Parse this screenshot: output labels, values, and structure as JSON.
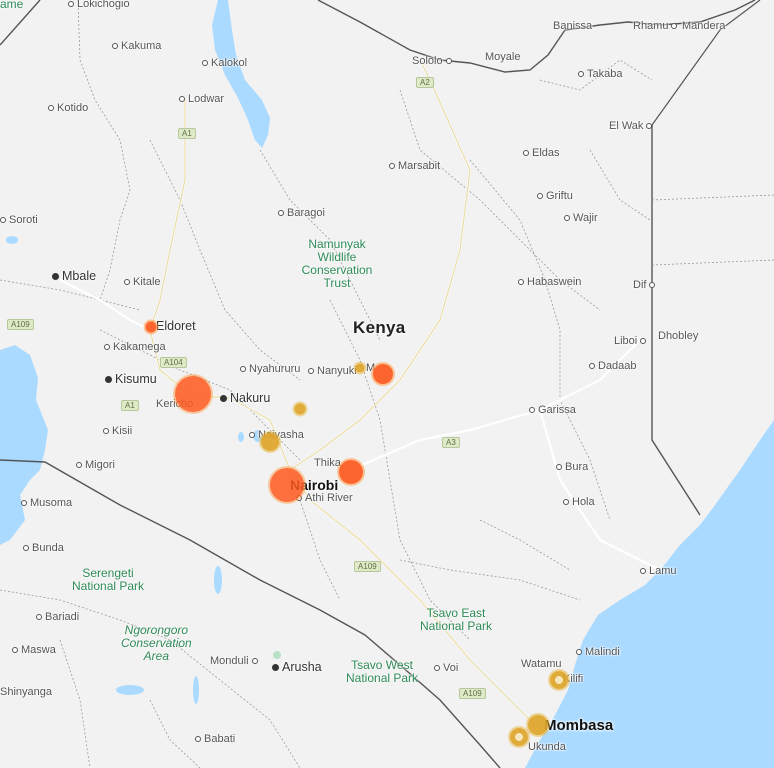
{
  "country": "Kenya",
  "colors": {
    "land": "#f2f2f2",
    "water": "#aadaff",
    "park": "#2e8b57",
    "marker_red": "#ff5a1f",
    "marker_gold": "#e0a52a"
  },
  "labels": {
    "lokichogio": "Lokichogio",
    "ame": "ame",
    "banissa": "Banissa",
    "rhamu": "Rhamu",
    "mandera": "Mandera",
    "kakuma": "Kakuma",
    "kalokol": "Kalokol",
    "sololo": "Sololo",
    "moyale": "Moyale",
    "takaba": "Takaba",
    "lodwar": "Lodwar",
    "kotido": "Kotido",
    "elwak": "El Wak",
    "marsabit": "Marsabit",
    "eldas": "Eldas",
    "griftu": "Griftu",
    "soroti": "Soroti",
    "baragoi": "Baragoi",
    "wajir": "Wajir",
    "mbale": "Mbale",
    "kitale": "Kitale",
    "habaswein": "Habaswein",
    "dif": "Dif",
    "eldoret": "Eldoret",
    "liboi": "Liboi",
    "dhobley": "Dhobley",
    "kakamega": "Kakamega",
    "nyahururu": "Nyahururu",
    "nanyuki": "Nanyuki",
    "meru_partial": "M",
    "dadaab": "Dadaab",
    "kisumu": "Kisumu",
    "kericho": "Kericho",
    "nakuru": "Nakuru",
    "garissa": "Garissa",
    "kisii": "Kisii",
    "naivasha": "Naivasha",
    "migori": "Migori",
    "thika": "Thika",
    "bura": "Bura",
    "nairobi": "Nairobi",
    "athiriver": "Athi River",
    "musoma": "Musoma",
    "hola": "Hola",
    "bunda": "Bunda",
    "lamu": "Lamu",
    "bariadi": "Bariadi",
    "malindi": "Malindi",
    "maswa": "Maswa",
    "monduli": "Monduli",
    "arusha": "Arusha",
    "voi": "Voi",
    "watamu": "Watamu",
    "kilifi": "Kilifi",
    "shinyanga": "Shinyanga",
    "mombasa": "Mombasa",
    "babati": "Babati",
    "ukunda": "Ukunda"
  },
  "parks": {
    "namunyak": "Namunyak\nWildlife\nConservation\nTrust",
    "serengeti": "Serengeti\nNational Park",
    "ngorongoro": "Ngorongoro\nConservation\nArea",
    "tsavo_east": "Tsavo East\nNational Park",
    "tsavo_west": "Tsavo West\nNational Park"
  },
  "roads": {
    "a2": "A2",
    "a1": "A1",
    "a109_west": "A109",
    "a104": "A104",
    "a1_south": "A1",
    "a3": "A3",
    "a109_mid": "A109",
    "a109_coast": "A109"
  },
  "markers": [
    {
      "name": "marker-eldoret",
      "color": "red",
      "size": "small"
    },
    {
      "name": "marker-kericho",
      "color": "red",
      "size": "large"
    },
    {
      "name": "marker-meru",
      "color": "red",
      "size": "medium"
    },
    {
      "name": "marker-nanyuki",
      "color": "gold",
      "size": "tiny"
    },
    {
      "name": "marker-nyeri",
      "color": "gold",
      "size": "small"
    },
    {
      "name": "marker-naivasha",
      "color": "gold",
      "size": "medium"
    },
    {
      "name": "marker-machakos",
      "color": "red",
      "size": "medium"
    },
    {
      "name": "marker-nairobi",
      "color": "red",
      "size": "large"
    },
    {
      "name": "marker-kilifi",
      "color": "gold",
      "size": "small"
    },
    {
      "name": "marker-mombasa",
      "color": "gold",
      "size": "medium"
    },
    {
      "name": "marker-ukunda",
      "color": "gold",
      "size": "small"
    }
  ]
}
